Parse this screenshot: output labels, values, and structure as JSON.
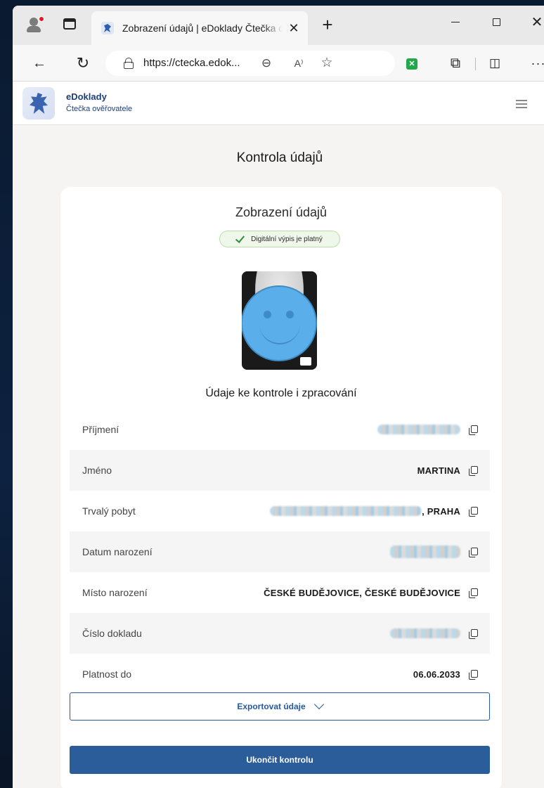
{
  "browser": {
    "tab_title": "Zobrazení údajů | eDoklady Čtečka ověřovatele",
    "url": "https://ctecka.edok..."
  },
  "site": {
    "brand_name": "eDoklady",
    "brand_subtitle": "Čtečka ověřovatele"
  },
  "page": {
    "title": "Kontrola údajů"
  },
  "card": {
    "title": "Zobrazení údajů",
    "valid_badge": "Digitální výpis je platný",
    "section_title": "Údaje ke kontrole i zpracování",
    "rows": [
      {
        "label": "Příjmení",
        "value": "",
        "redacted": true
      },
      {
        "label": "Jméno",
        "value": "MARTINA",
        "redacted": false
      },
      {
        "label": "Trvalý pobyt",
        "value": ", PRAHA",
        "redacted": true
      },
      {
        "label": "Datum narození",
        "value": "",
        "redacted": true
      },
      {
        "label": "Místo narození",
        "value": "ČESKÉ BUDĚJOVICE, ČESKÉ BUDĚJOVICE",
        "redacted": false
      },
      {
        "label": "Číslo dokladu",
        "value": "",
        "redacted": true
      },
      {
        "label": "Platnost do",
        "value": "06.06.2033",
        "redacted": false
      }
    ],
    "export_button": "Exportovat údaje",
    "end_button": "Ukončit kontrolu"
  },
  "colors": {
    "brand_blue": "#2a5d9a",
    "valid_green": "#2f8a3a"
  }
}
